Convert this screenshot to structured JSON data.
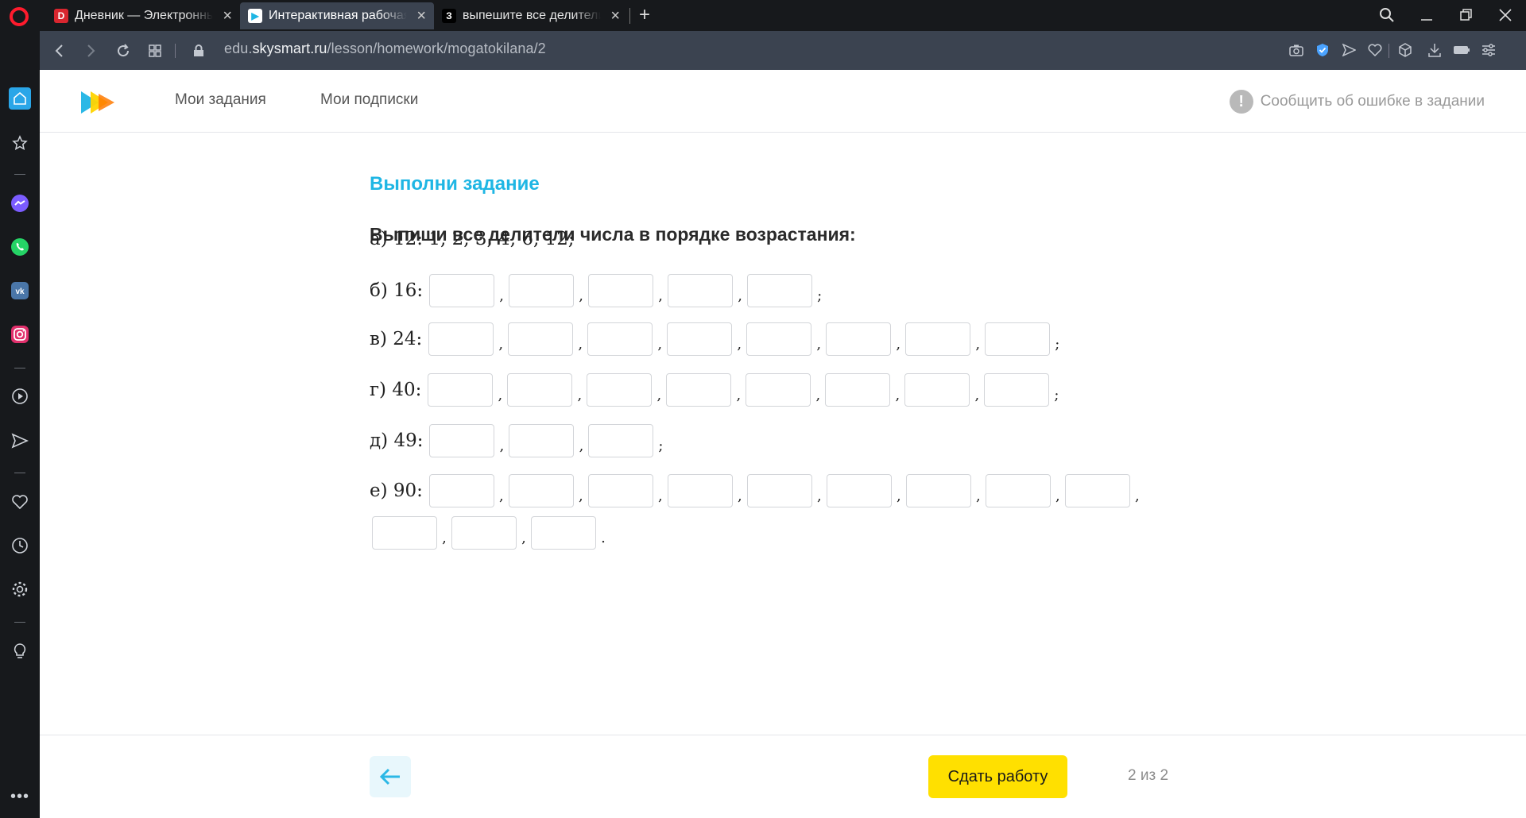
{
  "browser": {
    "tabs": [
      {
        "title": "Дневник — Электронный",
        "favicon": "D"
      },
      {
        "title": "Интерактивная рабочая т",
        "favicon": "▶"
      },
      {
        "title": "выпешите все делители ч",
        "favicon": "З"
      }
    ],
    "url_prefix": "edu.",
    "url_domain": "skysmart.ru",
    "url_path": "/lesson/homework/mogatokilana/2"
  },
  "header": {
    "nav": [
      "Мои задания",
      "Мои подписки"
    ],
    "report_label": "Сообщить об ошибке в задании"
  },
  "task": {
    "title": "Выполни задание",
    "instruction": "Выпиши все делители числа в порядке возрастания:",
    "rows": [
      {
        "label": "а) 12: 1, 2, 3, 4, 6, 12;",
        "boxes": 0,
        "end": ""
      },
      {
        "label": "б) 16:",
        "boxes": 5,
        "end": ";"
      },
      {
        "label": "в) 24:",
        "boxes": 8,
        "end": ";"
      },
      {
        "label": "г) 40:",
        "boxes": 8,
        "end": ";"
      },
      {
        "label": "д) 49:",
        "boxes": 3,
        "end": ";"
      },
      {
        "label": "е) 90:",
        "boxes": 9,
        "end": ","
      },
      {
        "label": "",
        "boxes": 3,
        "end": "."
      }
    ]
  },
  "footer": {
    "submit_label": "Сдать работу",
    "page_count": "2 из 2"
  },
  "colors": {
    "accent": "#1fb6e4",
    "submit": "#ffe000",
    "sidebar_bg": "#17191c",
    "addressbar_bg": "#3b4350"
  }
}
